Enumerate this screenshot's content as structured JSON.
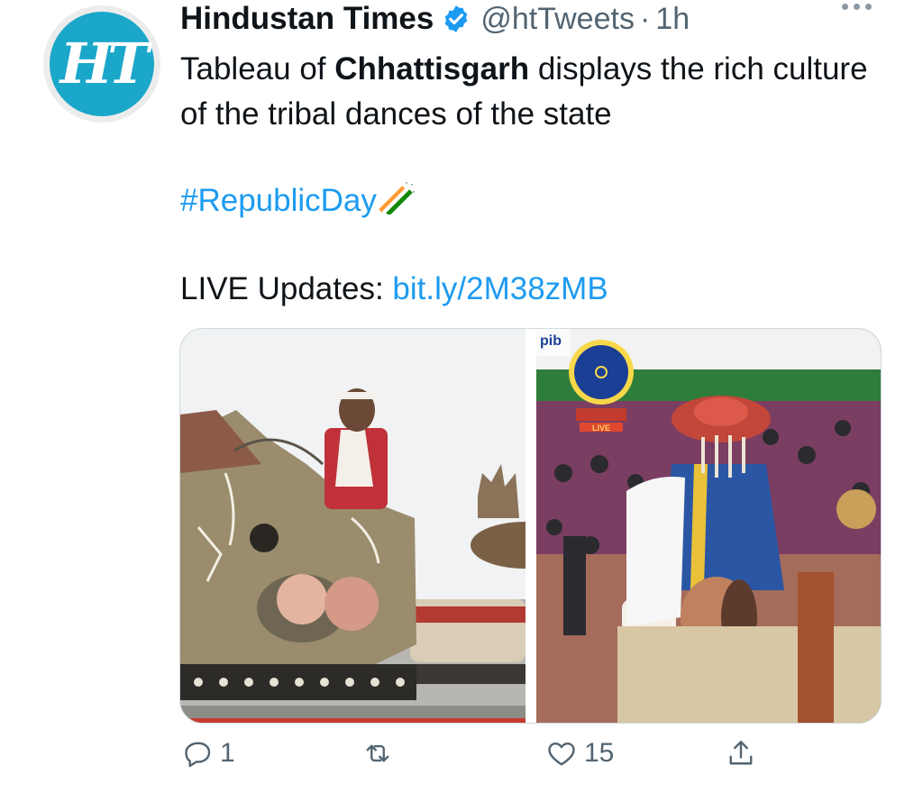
{
  "tweet": {
    "author_name": "Hindustan Times",
    "handle": "@htTweets",
    "separator": "·",
    "time": "1h",
    "avatar_text": "HT",
    "text_pre": "Tableau of ",
    "text_bold": "Chhattisgarh",
    "text_post": " displays the rich culture of the tribal dances of the state",
    "hashtag": "#RepublicDay",
    "live_label": "LIVE Updates: ",
    "live_link": "bit.ly/2M38zMB",
    "media": {
      "images": [
        {
          "id": "tableau-float"
        },
        {
          "id": "tribal-drummer",
          "overlay_text": "LIVE",
          "logo_text": "pib"
        }
      ]
    }
  },
  "actions": {
    "reply_count": "1",
    "retweet_count": "",
    "like_count": "15"
  },
  "colors": {
    "link": "#1d9bf0",
    "secondary": "#536471",
    "avatar_bg": "#1aa7c9"
  }
}
